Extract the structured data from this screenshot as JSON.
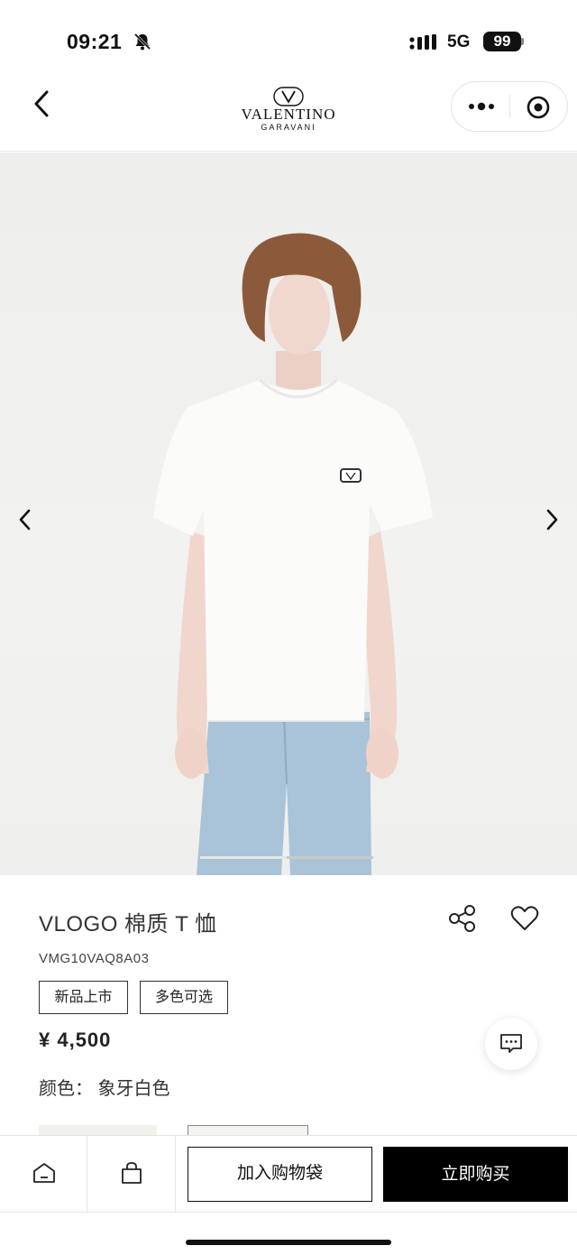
{
  "status_bar": {
    "time": "09:21",
    "network": "5G",
    "battery": "99",
    "icons": [
      "bell-muted-icon",
      "signal-icon"
    ]
  },
  "nav": {
    "brand_name": "VALENTINO",
    "brand_sub": "GARAVANI",
    "icons": [
      "back-icon",
      "more-icon",
      "close-target-icon"
    ]
  },
  "gallery": {
    "progress_fraction": 0.5,
    "icons": [
      "chevron-left-icon",
      "chevron-right-icon"
    ]
  },
  "product": {
    "title": "VLOGO 棉质 T 恤",
    "sku": "VMG10VAQ8A03",
    "tags": [
      "新品上市",
      "多色可选"
    ],
    "price": "¥ 4,500",
    "color_label": "颜色：  象牙白色",
    "icons": [
      "share-icon",
      "heart-icon",
      "chat-icon"
    ]
  },
  "bottom_bar": {
    "add_to_bag": "加入购物袋",
    "buy_now": "立即购买",
    "icons": [
      "home-icon",
      "bag-icon"
    ]
  }
}
